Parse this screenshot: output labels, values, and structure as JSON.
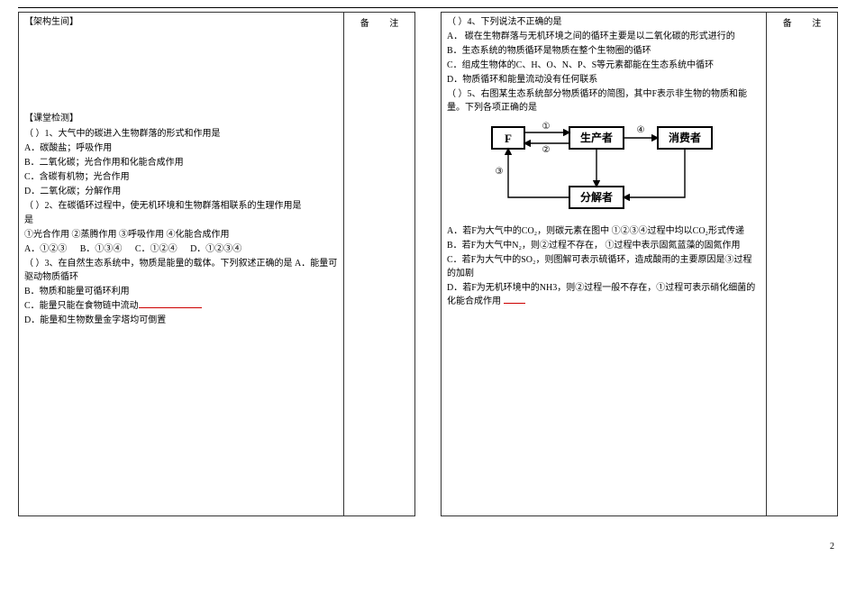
{
  "notes_label": "备  注",
  "page_number": "2",
  "left": {
    "section1": "【架构生间】",
    "section2": "【课堂检测】",
    "q1": {
      "stem": "（      ）1、大气中的碳进入生物群落的形式和作用是",
      "a": "A．碳酸盐；呼吸作用",
      "b": "B．二氧化碳；光合作用和化能合成作用",
      "c": "C．含碳有机物；光合作用",
      "d": "D．二氧化碳；分解作用"
    },
    "q2": {
      "stem": "（      ）2、在碳循环过程中，使无机环境和生物群落相联系的生理作用是",
      "opts_line": "①光合作用      ②蒸腾作用      ③呼吸作用      ④化能合成作用",
      "a": "A．①②③",
      "b": "B．①③④",
      "c": "C．①②④",
      "d": "D．①②③④"
    },
    "q3": {
      "stem": "（      ）3、在自然生态系统中，物质是能量的载体。下列叙述正确的是 A．能量可驱动物质循环",
      "b": "B．物质和能量可循环利用",
      "c": "C．能量只能在食物链中流动",
      "d": "D．能量和生物数量金字塔均可倒置"
    }
  },
  "right": {
    "q4": {
      "stem": "（      ）4、下列说法不正确的是",
      "a": "A． 碳在生物群落与无机环境之间的循环主要是以二氧化碳的形式进行的",
      "b": "B．生态系统的物质循环是物质在整个生物圈的循环",
      "c": "C．组成生物体的C、H、O、N、P、S等元素都能在生态系统中循环",
      "d": "D．物质循环和能量流动没有任何联系"
    },
    "q5": {
      "intro": "（      ）5、右图某生态系统部分物质循环的简图，其中F表示非生物的物质和能量。下列各项正确的是",
      "a": "A．若F为大气中的CO₂，则碳元素在图中   ①②③④过程中均以CO₂形式传递",
      "b": "B．若F为大气中N₂，则②过程不存在，   ①过程中表示固氮蓝藻的固氮作用",
      "c": "C．若F为大气中的SO₂，则图解可表示硫循环，造成酸雨的主要原因是③过程的加剧",
      "d": "D．若F为无机环境中的NH3，则②过程一般不存在，①过程可表示硝化细菌的化能合成作用"
    },
    "diagram": {
      "f": "F",
      "producer": "生产者",
      "consumer": "消费者",
      "decomposer": "分解者",
      "l1": "①",
      "l2": "②",
      "l3": "③",
      "l4": "④"
    }
  }
}
